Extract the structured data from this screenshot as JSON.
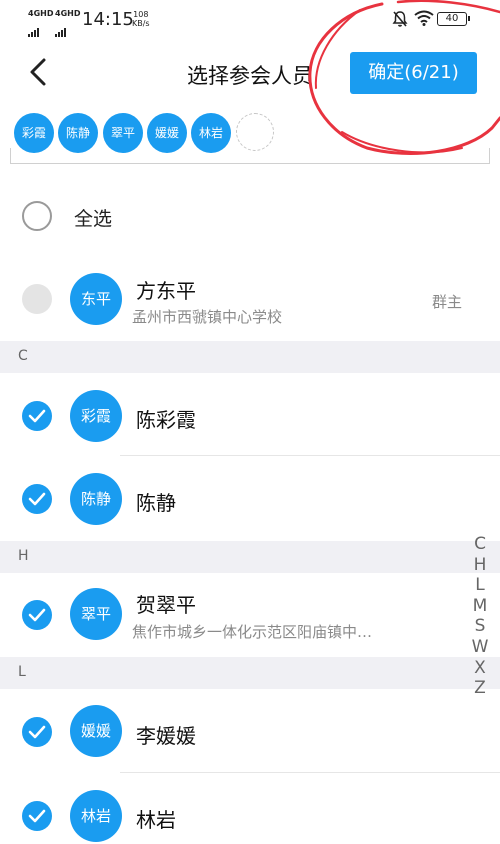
{
  "status": {
    "net1": "4G",
    "net1_sup": "HD",
    "net2": "4G",
    "net2_sup": "HD",
    "time": "14:15",
    "speed_value": "108",
    "speed_unit": "KB/s",
    "battery": "40"
  },
  "header": {
    "title": "选择参会人员",
    "confirm_label": "确定(6/21)"
  },
  "selected_chips": [
    "彩霞",
    "陈静",
    "翠平",
    "媛媛",
    "林岩"
  ],
  "select_all_label": "全选",
  "owner": {
    "avatar": "东平",
    "name": "方东平",
    "sub": "孟州市西虢镇中心学校",
    "role": "群主"
  },
  "sections": {
    "c": "C",
    "h": "H",
    "l": "L"
  },
  "members": [
    {
      "avatar": "彩霞",
      "name": "陈彩霞"
    },
    {
      "avatar": "陈静",
      "name": "陈静"
    },
    {
      "avatar": "翠平",
      "name": "贺翠平",
      "sub": "焦作市城乡一体化示范区阳庙镇中…"
    },
    {
      "avatar": "媛媛",
      "name": "李媛媛"
    },
    {
      "avatar": "林岩",
      "name": "林岩"
    }
  ],
  "index_letters": [
    "C",
    "H",
    "L",
    "M",
    "S",
    "W",
    "X",
    "Z"
  ],
  "colors": {
    "accent": "#1a9cf0",
    "annotation": "#e8333f",
    "section_bg": "#f0f0f4"
  }
}
